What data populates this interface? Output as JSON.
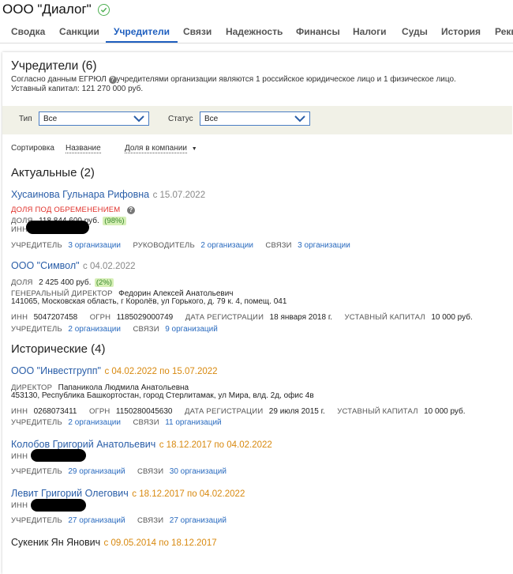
{
  "company": {
    "name": "ООО \"Диалог\""
  },
  "tabs": [
    {
      "label": "Сводка"
    },
    {
      "label": "Санкции"
    },
    {
      "label": "Учредители"
    },
    {
      "label": "Связи"
    },
    {
      "label": "Надежность"
    },
    {
      "label": "Финансы"
    },
    {
      "label": "Налоги"
    },
    {
      "label": "Суды"
    },
    {
      "label": "История"
    },
    {
      "label": "Рекв"
    }
  ],
  "founders": {
    "heading": "Учредители (6)",
    "desc_prefix": "Согласно данным ЕГРЮЛ",
    "desc_suffix": "учредителями организации являются 1 российское юридическое лицо и 1 физическое лицо.",
    "capital_line": "Уставный капитал: 121 270 000 руб."
  },
  "filters": {
    "type_label": "Тип",
    "type_value": "Все",
    "status_label": "Статус",
    "status_value": "Все"
  },
  "sorting": {
    "label": "Сортировка",
    "by_name": "Название",
    "by_share": "Доля в компании",
    "arrow": "▼"
  },
  "actual": {
    "heading": "Актуальные (2)",
    "p1": {
      "name": "Хусаинова Гульнара Рифовна",
      "since": "с 15.07.2022",
      "encumbrance": "ДОЛЯ ПОД ОБРЕМЕНЕНИЕМ",
      "share_label": "ДОЛЯ",
      "share_value": "118 844 600 руб.",
      "share_pct": "(98%)",
      "inn_label": "ИНН",
      "founder_label": "УЧРЕДИТЕЛЬ",
      "founder_link": "3 организации",
      "head_label": "РУКОВОДИТЕЛЬ",
      "head_link": "2 организации",
      "links_label": "СВЯЗИ",
      "links_link": "3 организации"
    },
    "p2": {
      "name": "ООО \"Символ\"",
      "since": "с 04.02.2022",
      "share_label": "ДОЛЯ",
      "share_value": "2 425 400 руб.",
      "share_pct": "(2%)",
      "director_label": "ГЕНЕРАЛЬНЫЙ ДИРЕКТОР",
      "director_value": "Федорин Алексей Анатольевич",
      "address": "141065, Московская область, г Королёв, ул Горького, д. 79 к. 4, помещ. 041",
      "inn_label": "ИНН",
      "inn_value": "5047207458",
      "ogrn_label": "ОГРН",
      "ogrn_value": "1185029000749",
      "reg_label": "ДАТА РЕГИСТРАЦИИ",
      "reg_value": "18 января 2018 г.",
      "cap_label": "УСТАВНЫЙ КАПИТАЛ",
      "cap_value": "10 000 руб.",
      "founder_label": "УЧРЕДИТЕЛЬ",
      "founder_link": "2 организации",
      "links_label": "СВЯЗИ",
      "links_link": "9 организаций"
    }
  },
  "historic": {
    "heading": "Исторические (4)",
    "h1": {
      "name": "ООО \"Инвестгрупп\"",
      "period": "с 04.02.2022 по 15.07.2022",
      "director_label": "ДИРЕКТОР",
      "director_value": "Папаникола Людмила Анатольевна",
      "address": "453130, Республика Башкортостан, город Стерлитамак, ул Мира, влд. 2д, офис 4в",
      "inn_label": "ИНН",
      "inn_value": "0268073411",
      "ogrn_label": "ОГРН",
      "ogrn_value": "1150280045630",
      "reg_label": "ДАТА РЕГИСТРАЦИИ",
      "reg_value": "29 июля 2015 г.",
      "cap_label": "УСТАВНЫЙ КАПИТАЛ",
      "cap_value": "10 000 руб.",
      "founder_label": "УЧРЕДИТЕЛЬ",
      "founder_link": "2 организации",
      "links_label": "СВЯЗИ",
      "links_link": "11 организаций"
    },
    "h2": {
      "name": "Колобов Григорий Анатольевич",
      "period": "с 18.12.2017 по 04.02.2022",
      "inn_label": "ИНН",
      "founder_label": "УЧРЕДИТЕЛЬ",
      "founder_link": "29 организаций",
      "links_label": "СВЯЗИ",
      "links_link": "30 организаций"
    },
    "h3": {
      "name": "Левит Григорий Олегович",
      "period": "с 18.12.2017 по 04.02.2022",
      "inn_label": "ИНН",
      "founder_label": "УЧРЕДИТЕЛЬ",
      "founder_link": "27 организаций",
      "links_label": "СВЯЗИ",
      "links_link": "27 организаций"
    },
    "h4": {
      "name": "Сукеник Ян Янович",
      "period": "с 09.05.2014 по 18.12.2017"
    }
  }
}
